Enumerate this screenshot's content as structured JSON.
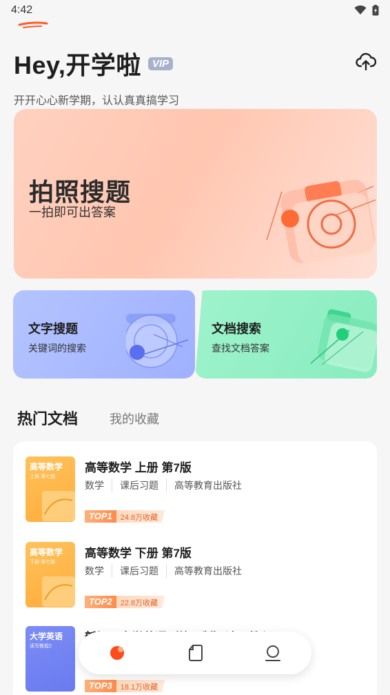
{
  "status": {
    "time": "4:42"
  },
  "header": {
    "greeting": "Hey,开学啦",
    "vip": "VIP",
    "subtitle": "开开心心新学期，认认真真搞学习"
  },
  "banner": {
    "title": "拍照搜题",
    "subtitle": "一拍即可出答案"
  },
  "cards": [
    {
      "title": "文字搜题",
      "subtitle": "关键词的搜索"
    },
    {
      "title": "文档搜索",
      "subtitle": "查找文档答案"
    }
  ],
  "tabs": {
    "active": "热门文档",
    "other": "我的收藏"
  },
  "documents": [
    {
      "title": "高等数学 上册 第7版",
      "tags": [
        "数学",
        "课后习题",
        "高等教育出版社"
      ],
      "rank": "TOP1",
      "favorites": "24.8万收藏",
      "cover_title": "高等数学",
      "cover_sub": "上册·第七版"
    },
    {
      "title": "高等数学 下册 第7版",
      "tags": [
        "数学",
        "课后习题",
        "高等教育出版社"
      ],
      "rank": "TOP2",
      "favorites": "22.8万收藏",
      "cover_title": "高等数学",
      "cover_sub": "下册·第七版"
    },
    {
      "title": "新视野大学英语（第三版）读写教程2",
      "rank": "TOP3",
      "favorites": "18.1万收藏",
      "cover_title": "大学英语",
      "cover_sub": "读写教程2"
    }
  ],
  "colors": {
    "accent": "#ff6a2e",
    "vip": "#a7b1c9"
  },
  "nav": [
    "home-icon",
    "document-icon",
    "profile-icon"
  ]
}
